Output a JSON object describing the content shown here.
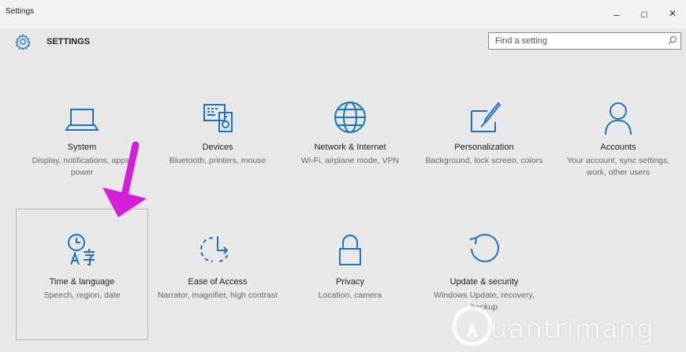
{
  "window": {
    "title": "Settings",
    "controls": {
      "minimize": "–",
      "maximize": "□",
      "close": "×"
    }
  },
  "header": {
    "title": "SETTINGS",
    "search_placeholder": "Find a setting"
  },
  "tiles": [
    {
      "label": "System",
      "desc": "Display, notifications, apps, power",
      "icon": "laptop-icon"
    },
    {
      "label": "Devices",
      "desc": "Bluetooth, printers, mouse",
      "icon": "devices-icon"
    },
    {
      "label": "Network & Internet",
      "desc": "Wi-Fi, airplane mode, VPN",
      "icon": "globe-icon"
    },
    {
      "label": "Personalization",
      "desc": "Background, lock screen, colors",
      "icon": "paintbrush-icon"
    },
    {
      "label": "Accounts",
      "desc": "Your account, sync settings, work, other users",
      "icon": "person-icon"
    },
    {
      "label": "Time & language",
      "desc": "Speech, region, date",
      "icon": "time-language-icon",
      "selected": true
    },
    {
      "label": "Ease of Access",
      "desc": "Narrator, magnifier, high contrast",
      "icon": "ease-of-access-icon"
    },
    {
      "label": "Privacy",
      "desc": "Location, camera",
      "icon": "lock-icon"
    },
    {
      "label": "Update & security",
      "desc": "Windows Update, recovery, backup",
      "icon": "update-icon"
    }
  ],
  "watermark": "uantrimang",
  "colors": {
    "accent": "#1e73be",
    "arrow": "#d41fd8",
    "background": "#e8e8e8"
  }
}
